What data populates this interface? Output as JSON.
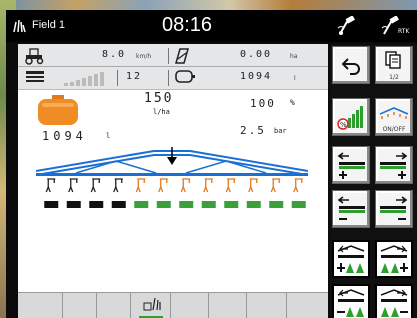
{
  "status": {
    "field_name": "Field 1",
    "clock": "08:16",
    "rtk_label": "RTK"
  },
  "info": {
    "speed_value": "8.0",
    "speed_unit": "km/h",
    "area_value": "0.00",
    "area_unit": "ha",
    "sections_value": "12",
    "tank_value": "1094",
    "tank_unit": "l"
  },
  "work": {
    "rate_value": "150",
    "rate_unit": "l/ha",
    "rate_percent": "100",
    "percent_sign": "%",
    "tank_amount": "1094",
    "tank_unit": "l",
    "pressure_value": "2.5",
    "pressure_unit": "bar",
    "total_sections": 12,
    "sections_off": 4
  },
  "right_panel": {
    "page_label": "1/2",
    "onoff_label": "ON/OFF"
  },
  "colors": {
    "boom_blue": "#1a6fd6",
    "section_on": "#3aa13a",
    "section_off": "#111111",
    "nozzle_on": "#e07a1f",
    "tank_orange": "#f08c24",
    "level_green": "#2e9e2e"
  }
}
